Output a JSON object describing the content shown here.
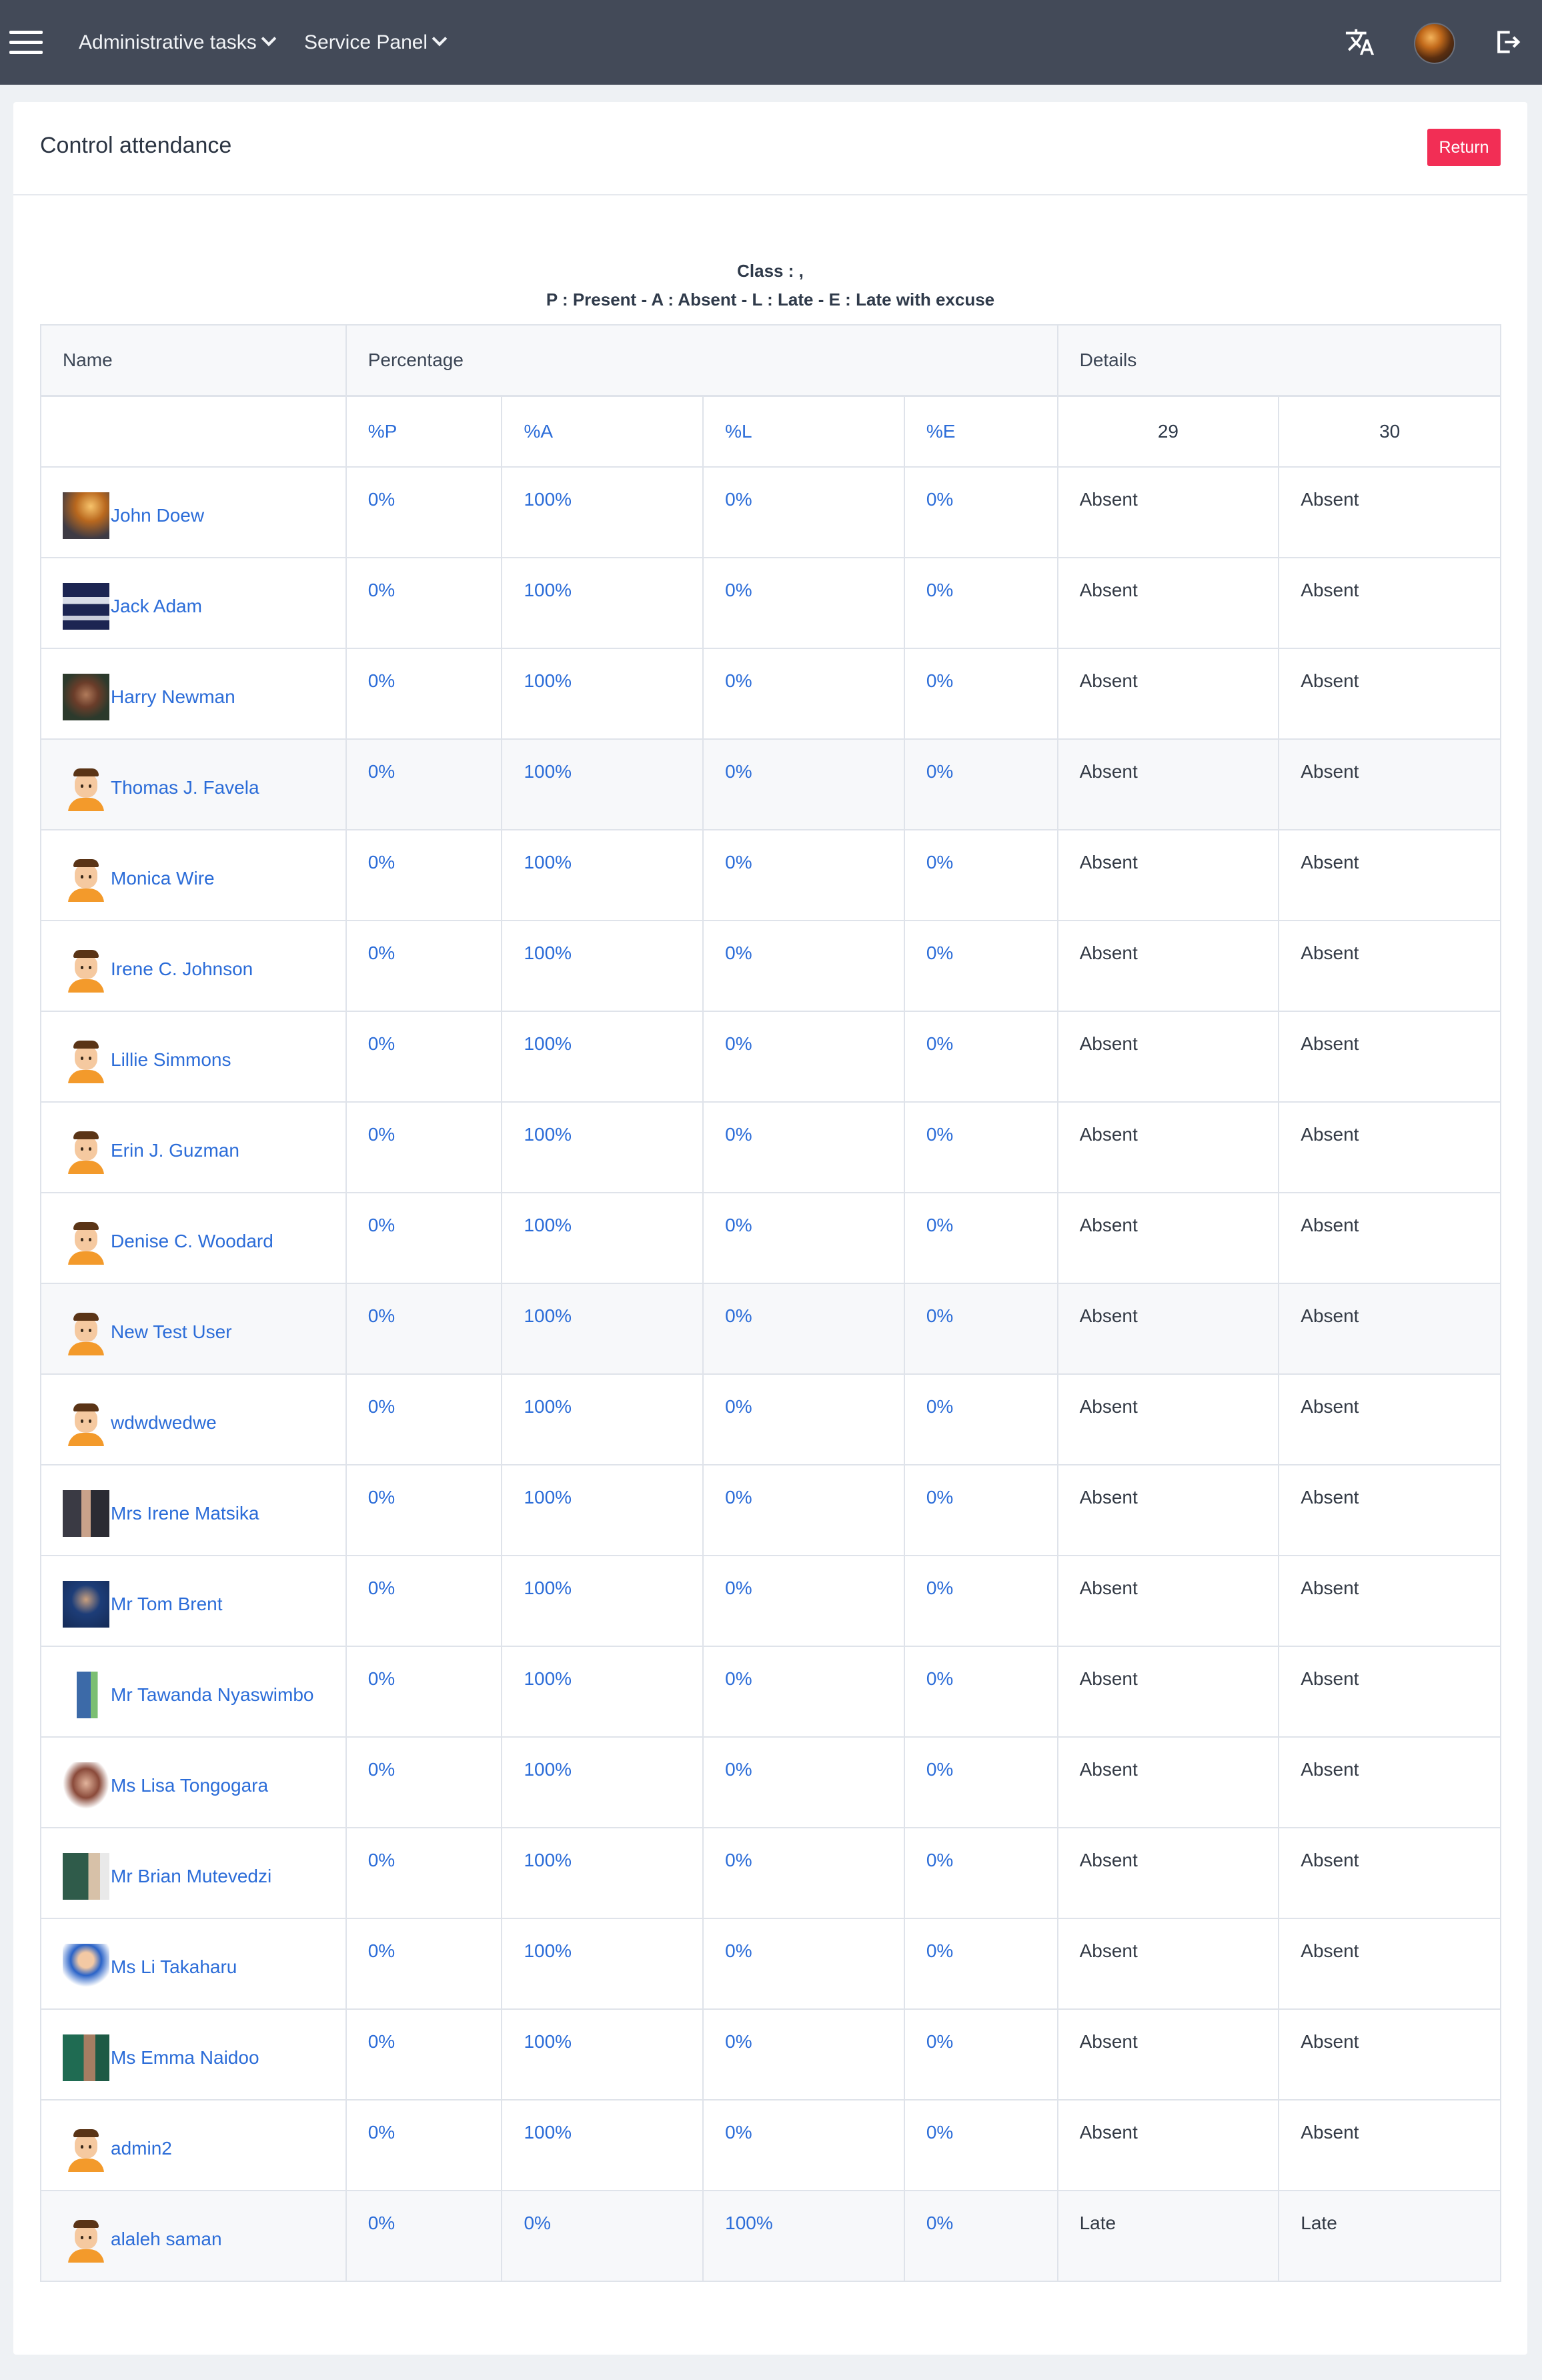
{
  "nav": {
    "menu1": "Administrative tasks",
    "menu2": "Service Panel",
    "icons": [
      "menu-icon",
      "translate-icon",
      "user-avatar",
      "logout-icon"
    ]
  },
  "page": {
    "title": "Control attendance",
    "return_label": "Return",
    "class_line": "Class : ,",
    "legend_line": "P : Present - A : Absent - L : Late - E : Late with excuse"
  },
  "table": {
    "headers": {
      "name": "Name",
      "percentage": "Percentage",
      "details": "Details"
    },
    "subheaders": {
      "p": "%P",
      "a": "%A",
      "l": "%L",
      "e": "%E",
      "day1": "29",
      "day2": "30"
    },
    "rows": [
      {
        "name": "John Doew",
        "avatar": "photo-fire",
        "p": "0%",
        "a": "100%",
        "l": "0%",
        "e": "0%",
        "d1": "Absent",
        "d2": "Absent"
      },
      {
        "name": "Jack Adam",
        "avatar": "photo-screen",
        "p": "0%",
        "a": "100%",
        "l": "0%",
        "e": "0%",
        "d1": "Absent",
        "d2": "Absent"
      },
      {
        "name": "Harry Newman",
        "avatar": "photo-man",
        "p": "0%",
        "a": "100%",
        "l": "0%",
        "e": "0%",
        "d1": "Absent",
        "d2": "Absent"
      },
      {
        "name": "Thomas J. Favela",
        "avatar": "cartoon",
        "p": "0%",
        "a": "100%",
        "l": "0%",
        "e": "0%",
        "d1": "Absent",
        "d2": "Absent"
      },
      {
        "name": "Monica Wire",
        "avatar": "cartoon",
        "p": "0%",
        "a": "100%",
        "l": "0%",
        "e": "0%",
        "d1": "Absent",
        "d2": "Absent"
      },
      {
        "name": "Irene C. Johnson",
        "avatar": "cartoon",
        "p": "0%",
        "a": "100%",
        "l": "0%",
        "e": "0%",
        "d1": "Absent",
        "d2": "Absent"
      },
      {
        "name": "Lillie Simmons",
        "avatar": "cartoon",
        "p": "0%",
        "a": "100%",
        "l": "0%",
        "e": "0%",
        "d1": "Absent",
        "d2": "Absent"
      },
      {
        "name": "Erin J. Guzman",
        "avatar": "cartoon",
        "p": "0%",
        "a": "100%",
        "l": "0%",
        "e": "0%",
        "d1": "Absent",
        "d2": "Absent"
      },
      {
        "name": "Denise C. Woodard",
        "avatar": "cartoon",
        "p": "0%",
        "a": "100%",
        "l": "0%",
        "e": "0%",
        "d1": "Absent",
        "d2": "Absent"
      },
      {
        "name": "New Test User",
        "avatar": "cartoon",
        "p": "0%",
        "a": "100%",
        "l": "0%",
        "e": "0%",
        "d1": "Absent",
        "d2": "Absent"
      },
      {
        "name": "wdwdwedwe",
        "avatar": "cartoon",
        "p": "0%",
        "a": "100%",
        "l": "0%",
        "e": "0%",
        "d1": "Absent",
        "d2": "Absent"
      },
      {
        "name": "Mrs Irene Matsika",
        "avatar": "photo-woman-dark",
        "p": "0%",
        "a": "100%",
        "l": "0%",
        "e": "0%",
        "d1": "Absent",
        "d2": "Absent"
      },
      {
        "name": "Mr Tom Brent",
        "avatar": "photo-man-blue",
        "p": "0%",
        "a": "100%",
        "l": "0%",
        "e": "0%",
        "d1": "Absent",
        "d2": "Absent"
      },
      {
        "name": "Mr Tawanda Nyaswimbo",
        "avatar": "photo-teacher",
        "p": "0%",
        "a": "100%",
        "l": "0%",
        "e": "0%",
        "d1": "Absent",
        "d2": "Absent"
      },
      {
        "name": "Ms Lisa Tongogara",
        "avatar": "photo-woman",
        "p": "0%",
        "a": "100%",
        "l": "0%",
        "e": "0%",
        "d1": "Absent",
        "d2": "Absent"
      },
      {
        "name": "Mr Brian Mutevedzi",
        "avatar": "photo-board",
        "p": "0%",
        "a": "100%",
        "l": "0%",
        "e": "0%",
        "d1": "Absent",
        "d2": "Absent"
      },
      {
        "name": "Ms Li Takaharu",
        "avatar": "photo-cartoon-boy",
        "p": "0%",
        "a": "100%",
        "l": "0%",
        "e": "0%",
        "d1": "Absent",
        "d2": "Absent"
      },
      {
        "name": "Ms Emma Naidoo",
        "avatar": "photo-green",
        "p": "0%",
        "a": "100%",
        "l": "0%",
        "e": "0%",
        "d1": "Absent",
        "d2": "Absent"
      },
      {
        "name": "admin2",
        "avatar": "cartoon",
        "p": "0%",
        "a": "100%",
        "l": "0%",
        "e": "0%",
        "d1": "Absent",
        "d2": "Absent"
      },
      {
        "name": "alaleh saman",
        "avatar": "cartoon",
        "p": "0%",
        "a": "0%",
        "l": "100%",
        "e": "0%",
        "d1": "Late",
        "d2": "Late"
      }
    ]
  },
  "colors": {
    "navbar": "#434a58",
    "link": "#2b6cd8",
    "return_button": "#f22e55"
  }
}
